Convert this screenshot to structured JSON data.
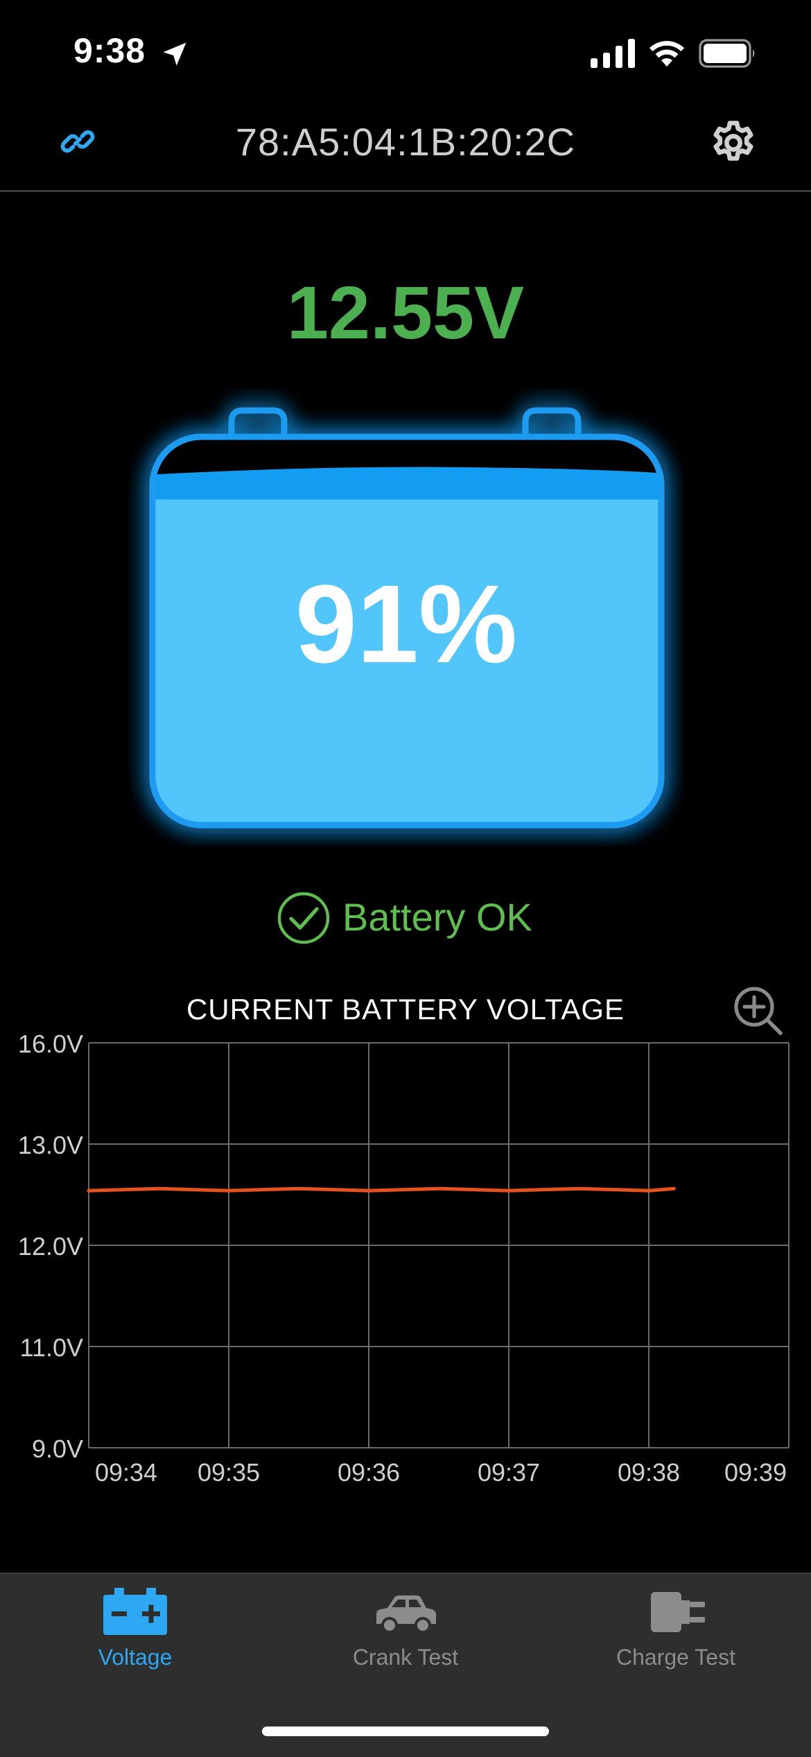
{
  "status_bar": {
    "time": "9:38",
    "icons": [
      "location-arrow-icon",
      "cellular-signal-icon",
      "wifi-icon",
      "battery-icon"
    ]
  },
  "header": {
    "device_address": "78:A5:04:1B:20:2C",
    "left_icon": "link-icon",
    "right_icon": "gear-icon"
  },
  "voltage_reading": "12.55V",
  "battery": {
    "percent_label": "91%",
    "charge_fraction": 0.91
  },
  "status": {
    "label": "Battery OK",
    "icon": "check-circle-icon"
  },
  "chart": {
    "zoom_icon": "zoom-in-icon"
  },
  "chart_data": {
    "type": "line",
    "title": "CURRENT BATTERY VOLTAGE",
    "xlabel": "",
    "ylabel": "",
    "y_tick_labels": [
      "16.0V",
      "13.0V",
      "12.0V",
      "11.0V",
      "9.0V"
    ],
    "x_tick_labels": [
      "09:34",
      "09:35",
      "09:36",
      "09:37",
      "09:38",
      "09:39"
    ],
    "grid": true,
    "series": [
      {
        "points_x_tick_index": [
          0,
          0.5,
          1,
          1.5,
          2,
          2.5,
          3,
          3.5,
          4,
          4.18
        ],
        "values": [
          12.55,
          12.55,
          12.55,
          12.55,
          12.55,
          12.55,
          12.55,
          12.55,
          12.55,
          12.55
        ]
      }
    ]
  },
  "tabs": [
    {
      "label": "Voltage",
      "icon": "battery-plus-minus-icon",
      "active": true
    },
    {
      "label": "Crank Test",
      "icon": "car-icon",
      "active": false
    },
    {
      "label": "Charge Test",
      "icon": "plug-icon",
      "active": false
    }
  ],
  "colors": {
    "accent_blue": "#2ea8f2",
    "voltage_green": "#4caf50",
    "status_green": "#5fbf4e",
    "battery_fill": "#52c5fb",
    "chart_line": "#e8521c",
    "inactive_gray": "#8c8c8c"
  }
}
